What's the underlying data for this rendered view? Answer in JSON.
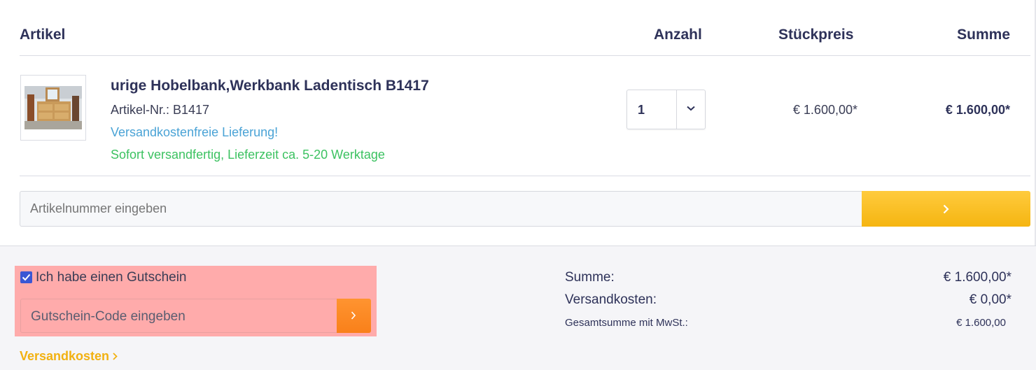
{
  "header": {
    "article": "Artikel",
    "quantity": "Anzahl",
    "unit_price": "Stückpreis",
    "sum": "Summe"
  },
  "item": {
    "title": "urige Hobelbank,Werkbank Ladentisch B1417",
    "article_number": "Artikel-Nr.: B1417",
    "shipping_note": "Versandkostenfreie Lieferung!",
    "availability": "Sofort versandfertig, Lieferzeit ca. 5-20 Werktage",
    "quantity": "1",
    "unit_price": "€ 1.600,00*",
    "total_price": "€ 1.600,00*"
  },
  "add_article": {
    "placeholder": "Artikelnummer eingeben"
  },
  "voucher": {
    "checked": true,
    "label": "Ich habe einen Gutschein",
    "placeholder": "Gutschein-Code eingeben"
  },
  "shipping_link": "Versandkosten",
  "summary": {
    "sum_label": "Summe:",
    "sum_value": "€ 1.600,00*",
    "shipping_label": "Versandkosten:",
    "shipping_value": "€ 0,00*",
    "grand_label": "Gesamtsumme mit MwSt.:",
    "grand_value": "€ 1.600,00"
  },
  "colors": {
    "primary_text": "#2e3259",
    "shipping_blue": "#4aa3d6",
    "availability_green": "#3cc261",
    "add_button": "#f5b511",
    "voucher_button": "#f9801a",
    "highlight": "#ffabab"
  },
  "icons": {
    "quantity_dropdown": "chevron-down-icon",
    "add_button": "chevron-right-icon",
    "voucher_button": "chevron-right-icon",
    "checkbox": "checkmark-icon"
  }
}
